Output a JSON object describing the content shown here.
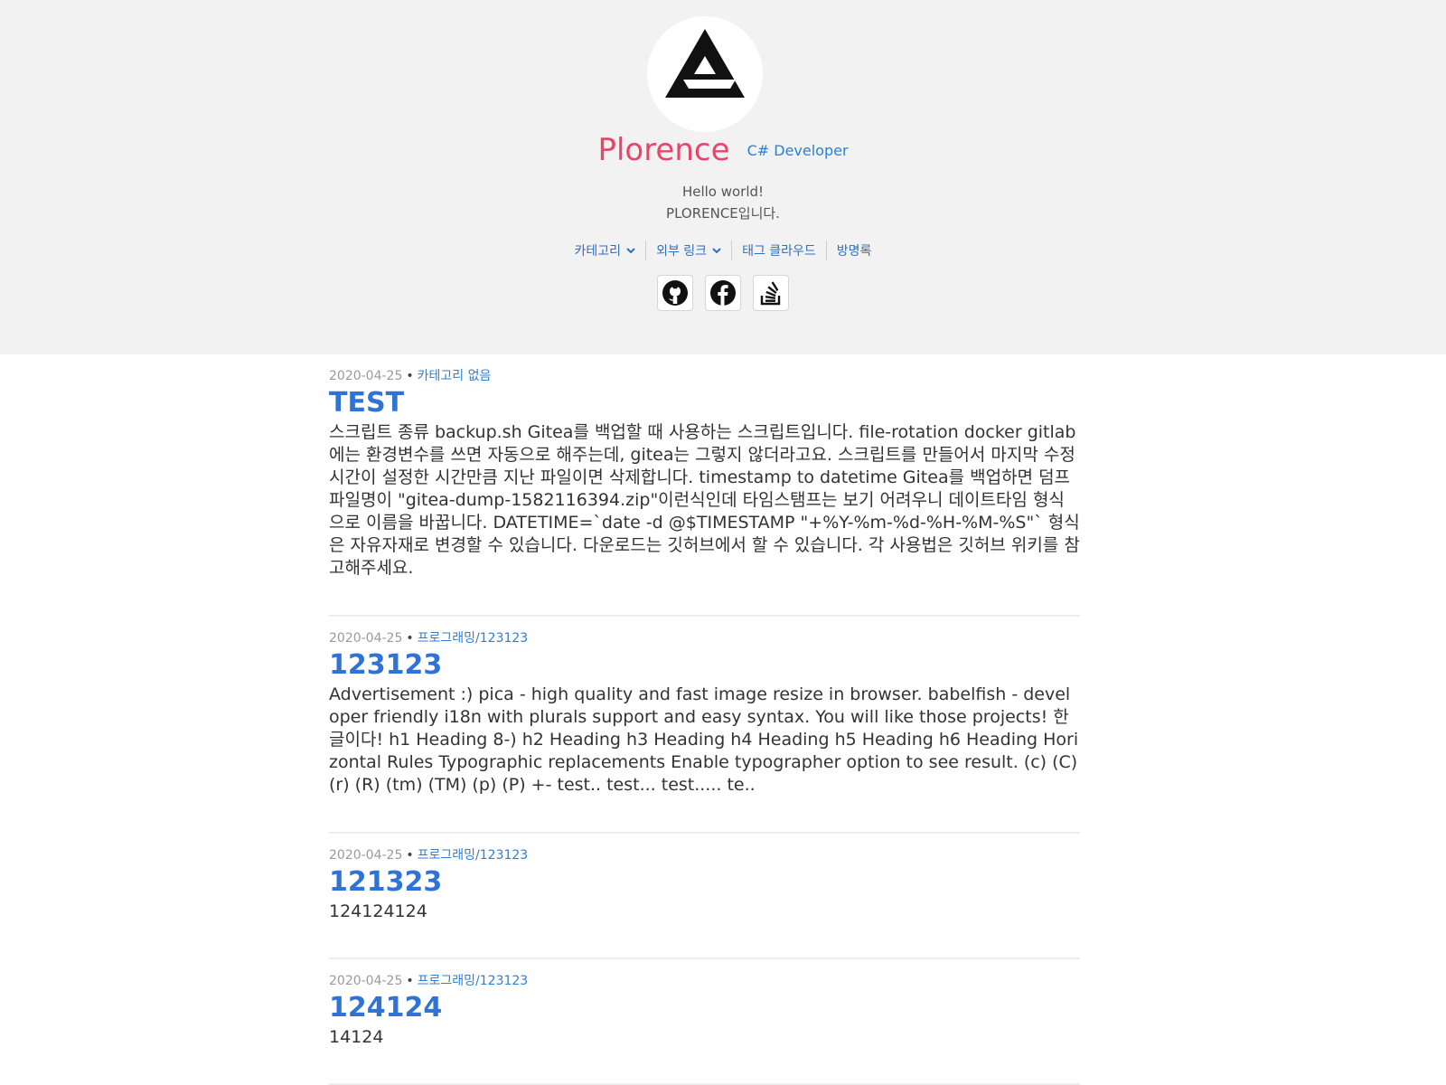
{
  "profile": {
    "name": "Plorence",
    "role": "C# Developer",
    "bio_line1": "Hello world!",
    "bio_line2": "PLORENCE입니다.",
    "avatar_icon": "triangle-logo-icon"
  },
  "nav": {
    "category": "카테고리",
    "external_links": "외부 링크",
    "tag_cloud": "태그 클라우드",
    "guestbook": "방명록"
  },
  "social": {
    "github_icon": "github-icon",
    "facebook_icon": "facebook-icon",
    "stackoverflow_icon": "stackoverflow-icon"
  },
  "colors": {
    "name": "#e8456b",
    "link": "#2f7fd1",
    "title": "#2f73d6",
    "header_bg": "#f2f2f2"
  },
  "posts": [
    {
      "date": "2020-04-25",
      "category": "카테고리 없음",
      "title": "TEST",
      "excerpt": "스크립트 종류 backup.sh Gitea를 백업할 때 사용하는 스크립트입니다. file-rotation docker gitlab에는 환경변수를 쓰면 자동으로 해주는데, gitea는 그렇지 않더라고요. 스크립트를 만들어서 마지막 수정 시간이 설정한 시간만큼 지난 파일이면 삭제합니다. timestamp to datetime Gitea를 백업하면 덤프 파일명이 \"gitea-dump-1582116394.zip\"이런식인데 타임스탬프는 보기 어려우니 데이트타임 형식으로 이름을 바꿉니다. DATETIME=`date -d @$TIMESTAMP \"+%Y-%m-%d-%H-%M-%S\"` 형식은 자유자재로 변경할 수 있습니다. 다운로드는 깃허브에서 할 수 있습니다. 각 사용법은 깃허브 위키를 참고해주세요."
    },
    {
      "date": "2020-04-25",
      "category": "프로그래밍/123123",
      "title": "123123",
      "excerpt": "Advertisement :) pica - high quality and fast image resize in browser. babelfish - developer friendly i18n with plurals support and easy syntax. You will like those projects! 한글이다! h1 Heading 8-) h2 Heading h3 Heading h4 Heading h5 Heading h6 Heading Horizontal Rules Typographic replacements Enable typographer option to see result. (c) (C) (r) (R) (tm) (TM) (p) (P) +- test.. test... test..... te.."
    },
    {
      "date": "2020-04-25",
      "category": "프로그래밍/123123",
      "title": "121323",
      "excerpt": "124124124"
    },
    {
      "date": "2020-04-25",
      "category": "프로그래밍/123123",
      "title": "124124",
      "excerpt": "14124"
    }
  ]
}
